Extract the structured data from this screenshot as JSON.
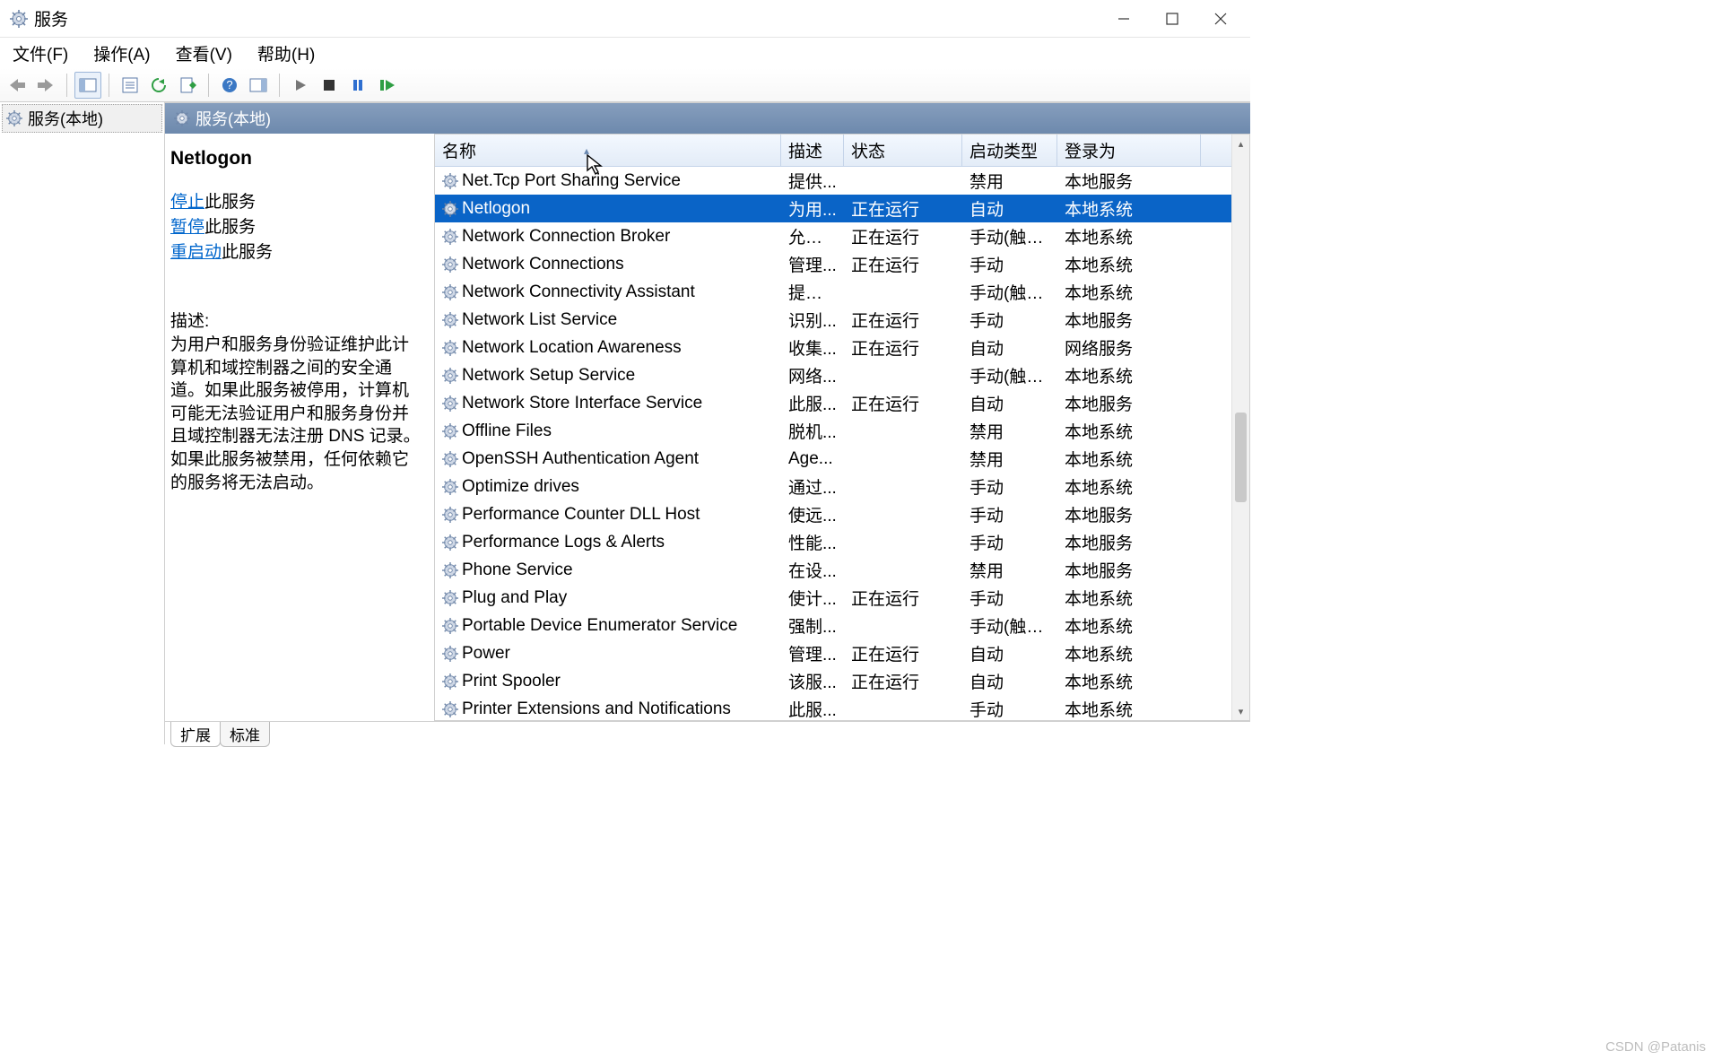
{
  "window": {
    "title": "服务"
  },
  "menus": {
    "file": "文件(F)",
    "action": "操作(A)",
    "view": "查看(V)",
    "help": "帮助(H)"
  },
  "tree": {
    "root": "服务(本地)"
  },
  "pane": {
    "title": "服务(本地)"
  },
  "detail": {
    "service_name": "Netlogon",
    "stop_link": "停止",
    "pause_link": "暂停",
    "restart_link": "重启动",
    "action_suffix": "此服务",
    "desc_label": "描述:",
    "desc_text": "为用户和服务身份验证维护此计算机和域控制器之间的安全通道。如果此服务被停用，计算机可能无法验证用户和服务身份并且域控制器无法注册 DNS 记录。如果此服务被禁用，任何依赖它的服务将无法启动。"
  },
  "columns": {
    "name": "名称",
    "desc": "描述",
    "status": "状态",
    "start": "启动类型",
    "logon": "登录为"
  },
  "services": [
    {
      "name": "Net.Tcp Port Sharing Service",
      "desc": "提供...",
      "status": "",
      "start": "禁用",
      "logon": "本地服务",
      "selected": false
    },
    {
      "name": "Netlogon",
      "desc": "为用...",
      "status": "正在运行",
      "start": "自动",
      "logon": "本地系统",
      "selected": true
    },
    {
      "name": "Network Connection Broker",
      "desc": "允许 ...",
      "status": "正在运行",
      "start": "手动(触发...",
      "logon": "本地系统",
      "selected": false
    },
    {
      "name": "Network Connections",
      "desc": "管理...",
      "status": "正在运行",
      "start": "手动",
      "logon": "本地系统",
      "selected": false
    },
    {
      "name": "Network Connectivity Assistant",
      "desc": "提供 ...",
      "status": "",
      "start": "手动(触发...",
      "logon": "本地系统",
      "selected": false
    },
    {
      "name": "Network List Service",
      "desc": "识别...",
      "status": "正在运行",
      "start": "手动",
      "logon": "本地服务",
      "selected": false
    },
    {
      "name": "Network Location Awareness",
      "desc": "收集...",
      "status": "正在运行",
      "start": "自动",
      "logon": "网络服务",
      "selected": false
    },
    {
      "name": "Network Setup Service",
      "desc": "网络...",
      "status": "",
      "start": "手动(触发...",
      "logon": "本地系统",
      "selected": false
    },
    {
      "name": "Network Store Interface Service",
      "desc": "此服...",
      "status": "正在运行",
      "start": "自动",
      "logon": "本地服务",
      "selected": false
    },
    {
      "name": "Offline Files",
      "desc": "脱机...",
      "status": "",
      "start": "禁用",
      "logon": "本地系统",
      "selected": false
    },
    {
      "name": "OpenSSH Authentication Agent",
      "desc": "Age...",
      "status": "",
      "start": "禁用",
      "logon": "本地系统",
      "selected": false
    },
    {
      "name": "Optimize drives",
      "desc": "通过...",
      "status": "",
      "start": "手动",
      "logon": "本地系统",
      "selected": false
    },
    {
      "name": "Performance Counter DLL Host",
      "desc": "使远...",
      "status": "",
      "start": "手动",
      "logon": "本地服务",
      "selected": false
    },
    {
      "name": "Performance Logs & Alerts",
      "desc": "性能...",
      "status": "",
      "start": "手动",
      "logon": "本地服务",
      "selected": false
    },
    {
      "name": "Phone Service",
      "desc": "在设...",
      "status": "",
      "start": "禁用",
      "logon": "本地服务",
      "selected": false
    },
    {
      "name": "Plug and Play",
      "desc": "使计...",
      "status": "正在运行",
      "start": "手动",
      "logon": "本地系统",
      "selected": false
    },
    {
      "name": "Portable Device Enumerator Service",
      "desc": "强制...",
      "status": "",
      "start": "手动(触发...",
      "logon": "本地系统",
      "selected": false
    },
    {
      "name": "Power",
      "desc": "管理...",
      "status": "正在运行",
      "start": "自动",
      "logon": "本地系统",
      "selected": false
    },
    {
      "name": "Print Spooler",
      "desc": "该服...",
      "status": "正在运行",
      "start": "自动",
      "logon": "本地系统",
      "selected": false
    },
    {
      "name": "Printer Extensions and Notifications",
      "desc": "此服...",
      "status": "",
      "start": "手动",
      "logon": "本地系统",
      "selected": false
    }
  ],
  "tabs": {
    "extended": "扩展",
    "standard": "标准"
  },
  "watermark": "CSDN @Patanis"
}
